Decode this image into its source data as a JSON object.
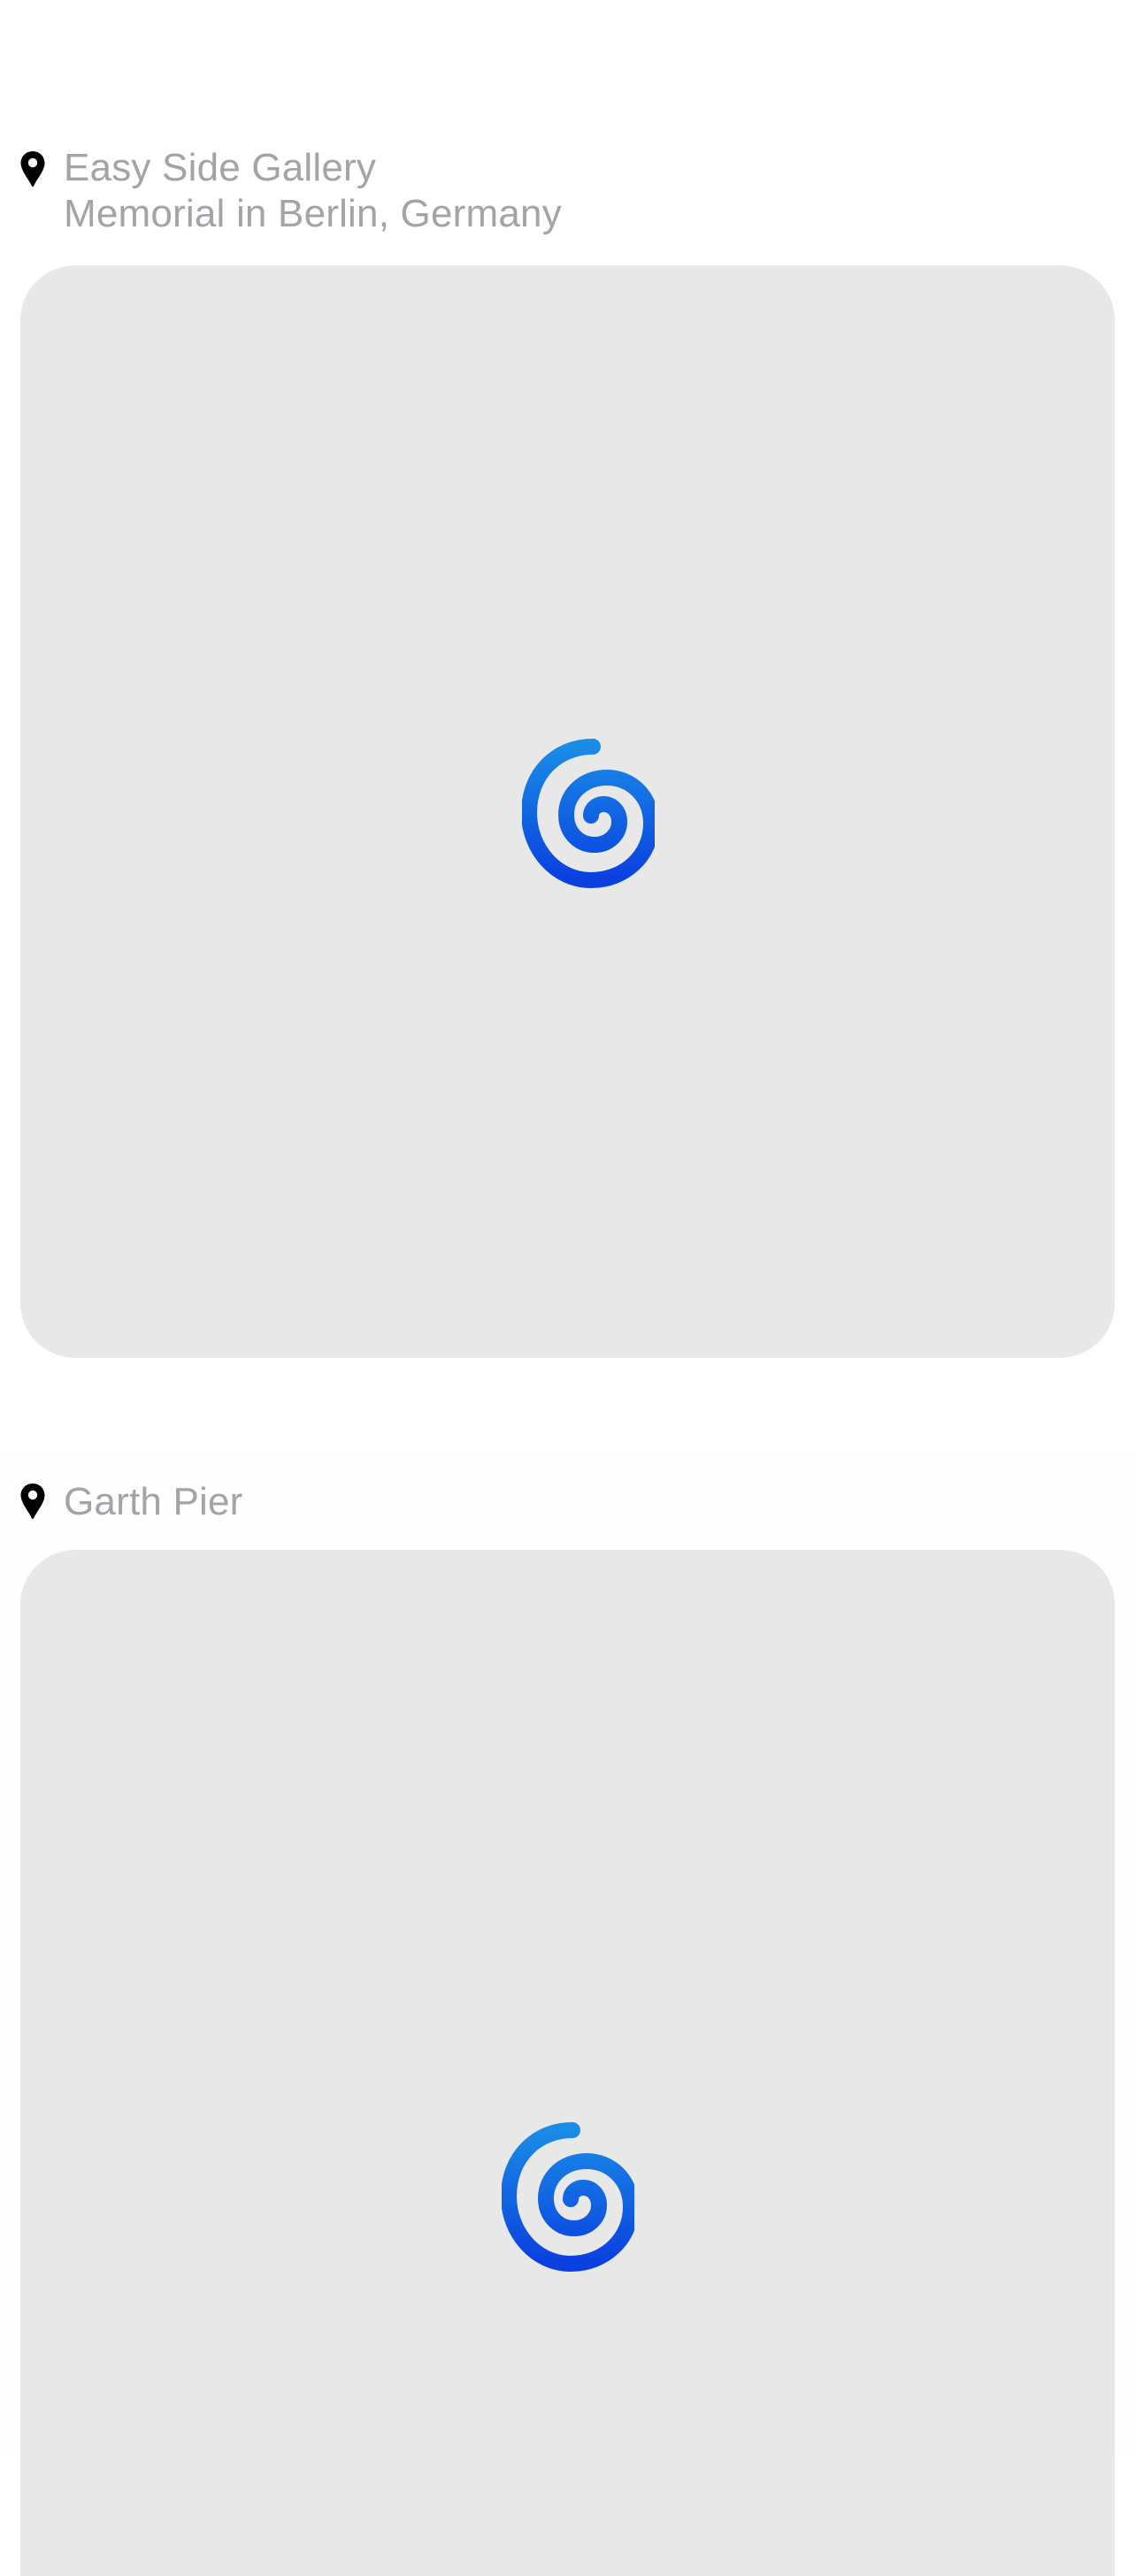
{
  "feed": {
    "posts": [
      {
        "location_line1": "Easy Side Gallery",
        "location_line2": "Memorial in Berlin, Germany",
        "media_state": "loading",
        "icons": {
          "location": "map-pin-icon",
          "loading": "spiral-loading-icon"
        }
      },
      {
        "location_line1": "Garth Pier",
        "media_state": "loading",
        "icons": {
          "location": "map-pin-icon",
          "loading": "spiral-loading-icon"
        }
      }
    ]
  },
  "colors": {
    "background": "#ffffff",
    "location_text": "#a3a3a8",
    "card_placeholder": "#e8e8e9",
    "spinner_light": "#1a8ce6",
    "spinner_dark": "#0a3fe0",
    "pin": "#000000"
  }
}
